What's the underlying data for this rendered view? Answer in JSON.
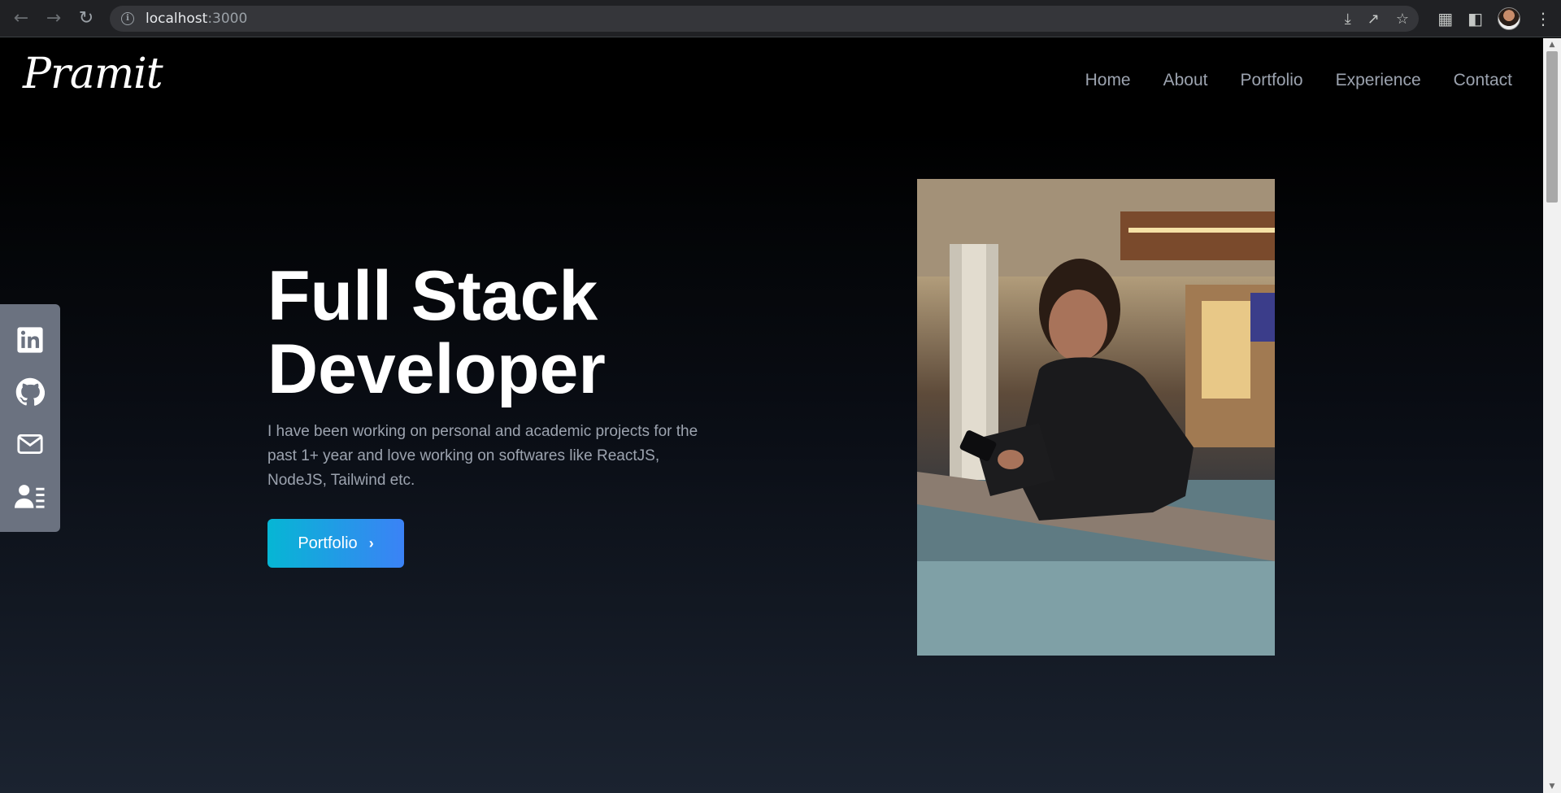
{
  "browser": {
    "url_host": "localhost",
    "url_port": ":3000"
  },
  "site": {
    "logo": "Pramit",
    "nav": [
      "Home",
      "About",
      "Portfolio",
      "Experience",
      "Contact"
    ]
  },
  "social": [
    {
      "name": "linkedin"
    },
    {
      "name": "github"
    },
    {
      "name": "mail"
    },
    {
      "name": "resume"
    }
  ],
  "hero": {
    "title_line1": "Full Stack",
    "title_line2": "Developer",
    "description": "I have been working on personal and academic projects for the past 1+ year and love working on softwares like ReactJS, NodeJS, Tailwind etc.",
    "button_label": "Portfolio",
    "button_gradient": [
      "#06b6d4",
      "#3b82f6"
    ]
  }
}
